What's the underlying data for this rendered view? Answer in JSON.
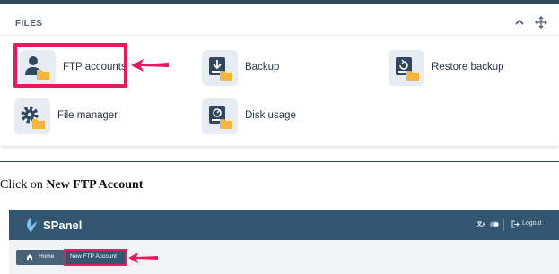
{
  "files_panel": {
    "title": "FILES",
    "controls": [
      "chevron-up-icon",
      "move-icon"
    ],
    "tiles": [
      {
        "label": "FTP accounts",
        "icon": "ftp-user-folder-icon",
        "highlighted": true
      },
      {
        "label": "Backup",
        "icon": "backup-drive-folder-icon"
      },
      {
        "label": "Restore backup",
        "icon": "restore-drive-folder-icon"
      },
      {
        "label": "File manager",
        "icon": "gear-folder-icon"
      },
      {
        "label": "Disk usage",
        "icon": "disk-usage-folder-icon"
      }
    ]
  },
  "instruction": {
    "prefix": "Click on ",
    "bold": "New FTP Account"
  },
  "spanel": {
    "logo": "SPanel",
    "nav": {
      "logout": "Logout"
    },
    "breadcrumb": {
      "home": "Home",
      "current": "New FTP Account"
    }
  },
  "colors": {
    "highlight": "#e8195c",
    "navbar": "#33556f",
    "tile_bg": "#e7ebf2",
    "folder": "#f5b43c",
    "icon_dark": "#2f4860"
  }
}
